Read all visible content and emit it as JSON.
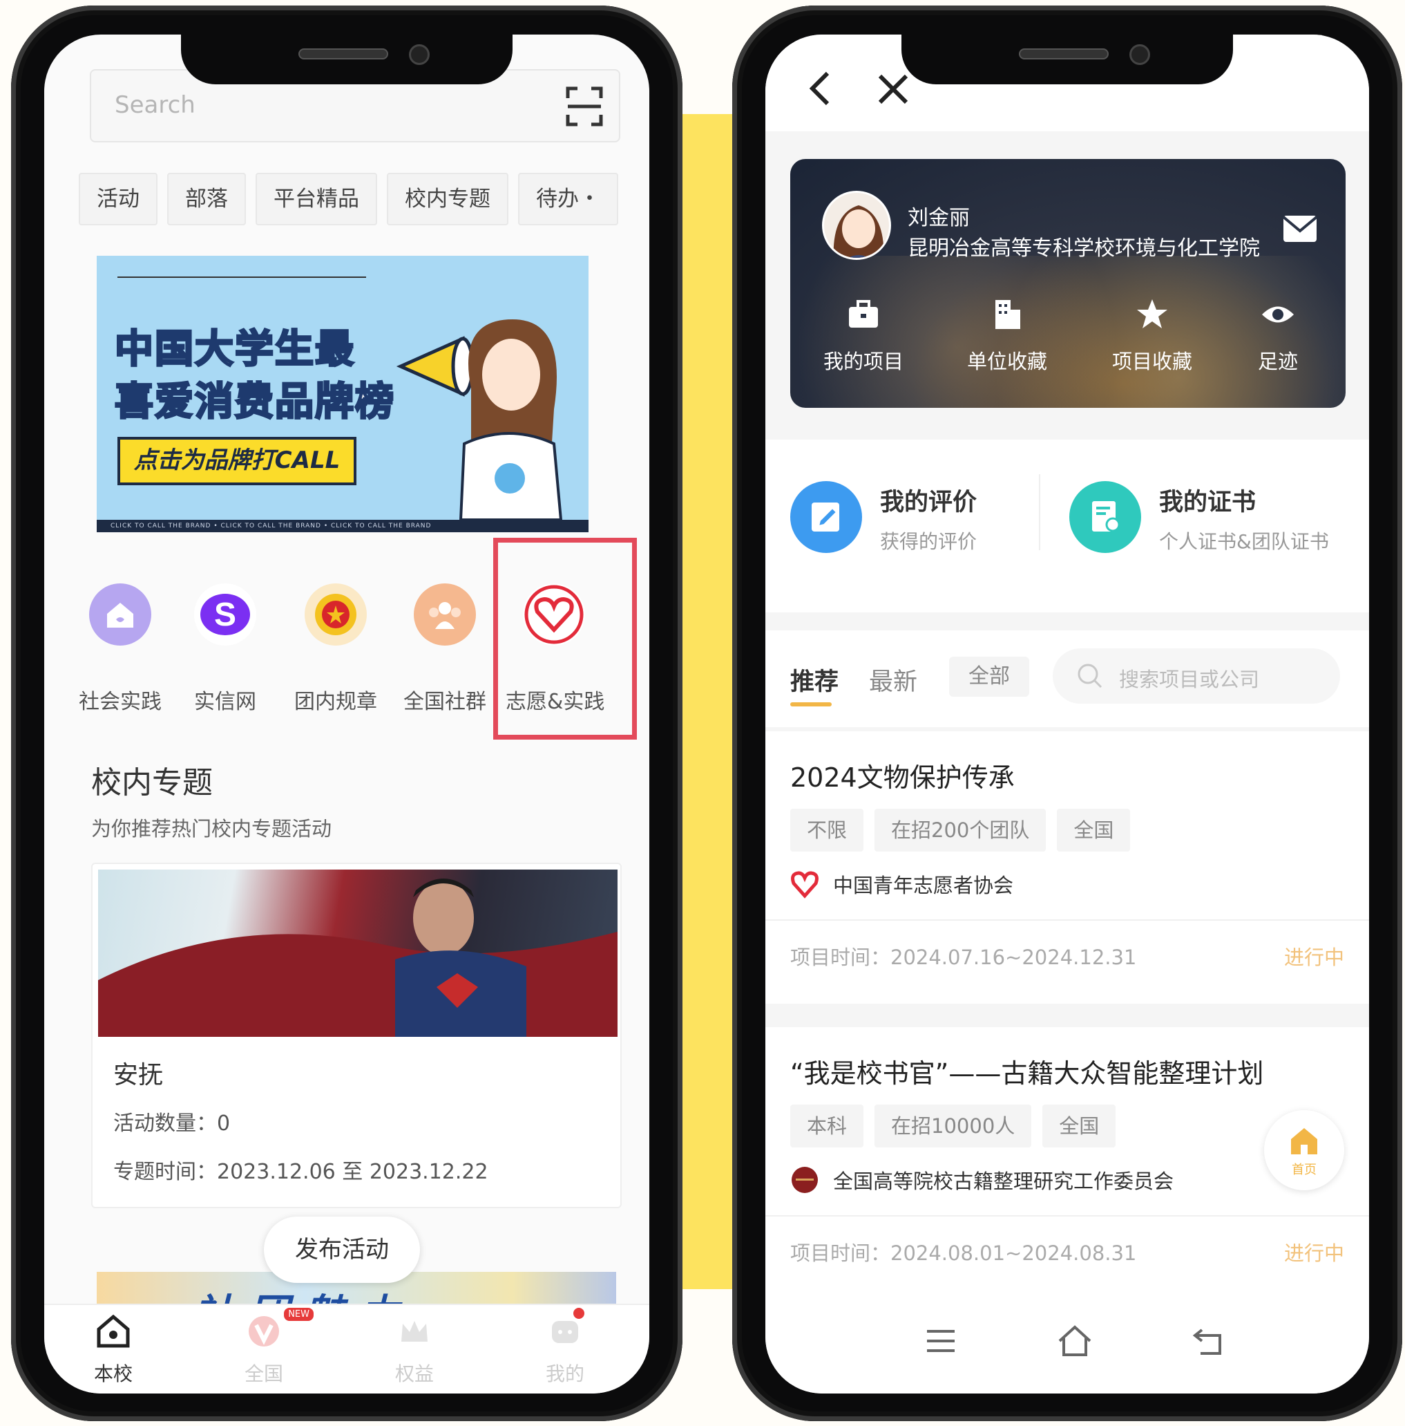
{
  "colors": {
    "accent_red": "#e34a5a",
    "status_orange": "#f2c27c",
    "tab_underline": "#f2b646",
    "background_yellow": "#fde35f"
  },
  "left_phone": {
    "search": {
      "placeholder": "Search"
    },
    "tabs": [
      "活动",
      "部落",
      "平台精品",
      "校内专题",
      "待办・"
    ],
    "banner": {
      "line1": "中国大学生最",
      "line2": "喜爱消费品牌榜",
      "button": "点击为品牌打CALL"
    },
    "quick_items": [
      {
        "label": "社会实践",
        "icon": "home-icon"
      },
      {
        "label": "实信网",
        "icon": "s-logo-icon"
      },
      {
        "label": "团内规章",
        "icon": "league-badge-icon"
      },
      {
        "label": "全国社群",
        "icon": "group-icon"
      },
      {
        "label": "志愿&实践",
        "icon": "volunteer-heart-icon"
      }
    ],
    "section": {
      "title": "校内专题",
      "subtitle": "为你推荐热门校内专题活动"
    },
    "topic_card": {
      "name": "安抚",
      "count": "活动数量：0",
      "time": "专题时间：2023.12.06 至 2023.12.22"
    },
    "publish_button": "发布活动",
    "club_banner": "社团魅力",
    "bottom_nav": [
      {
        "label": "本校",
        "active": true
      },
      {
        "label": "全国",
        "badge": "NEW"
      },
      {
        "label": "权益"
      },
      {
        "label": "我的"
      }
    ]
  },
  "right_phone": {
    "profile": {
      "name": "刘金丽",
      "school": "昆明冶金高等专科学校环境与化工学院",
      "actions": [
        "我的项目",
        "单位收藏",
        "项目收藏",
        "足迹"
      ]
    },
    "stats": [
      {
        "title": "我的评价",
        "sub": "获得的评价"
      },
      {
        "title": "我的证书",
        "sub": "个人证书&团队证书"
      }
    ],
    "filter": {
      "tabs": [
        "推荐",
        "最新"
      ],
      "all": "全部",
      "search_placeholder": "搜索项目或公司"
    },
    "projects": [
      {
        "title": "2024文物保护传承",
        "tags": [
          "不限",
          "在招200个团队",
          "全国"
        ],
        "org": "中国青年志愿者协会",
        "time": "项目时间：2024.07.16~2024.12.31",
        "status": "进行中"
      },
      {
        "title": "“我是校书官”——古籍大众智能整理计划",
        "tags": [
          "本科",
          "在招10000人",
          "全国"
        ],
        "org": "全国高等院校古籍整理研究工作委员会",
        "time": "项目时间：2024.08.01~2024.08.31",
        "status": "进行中"
      }
    ],
    "home_float": "首页"
  }
}
